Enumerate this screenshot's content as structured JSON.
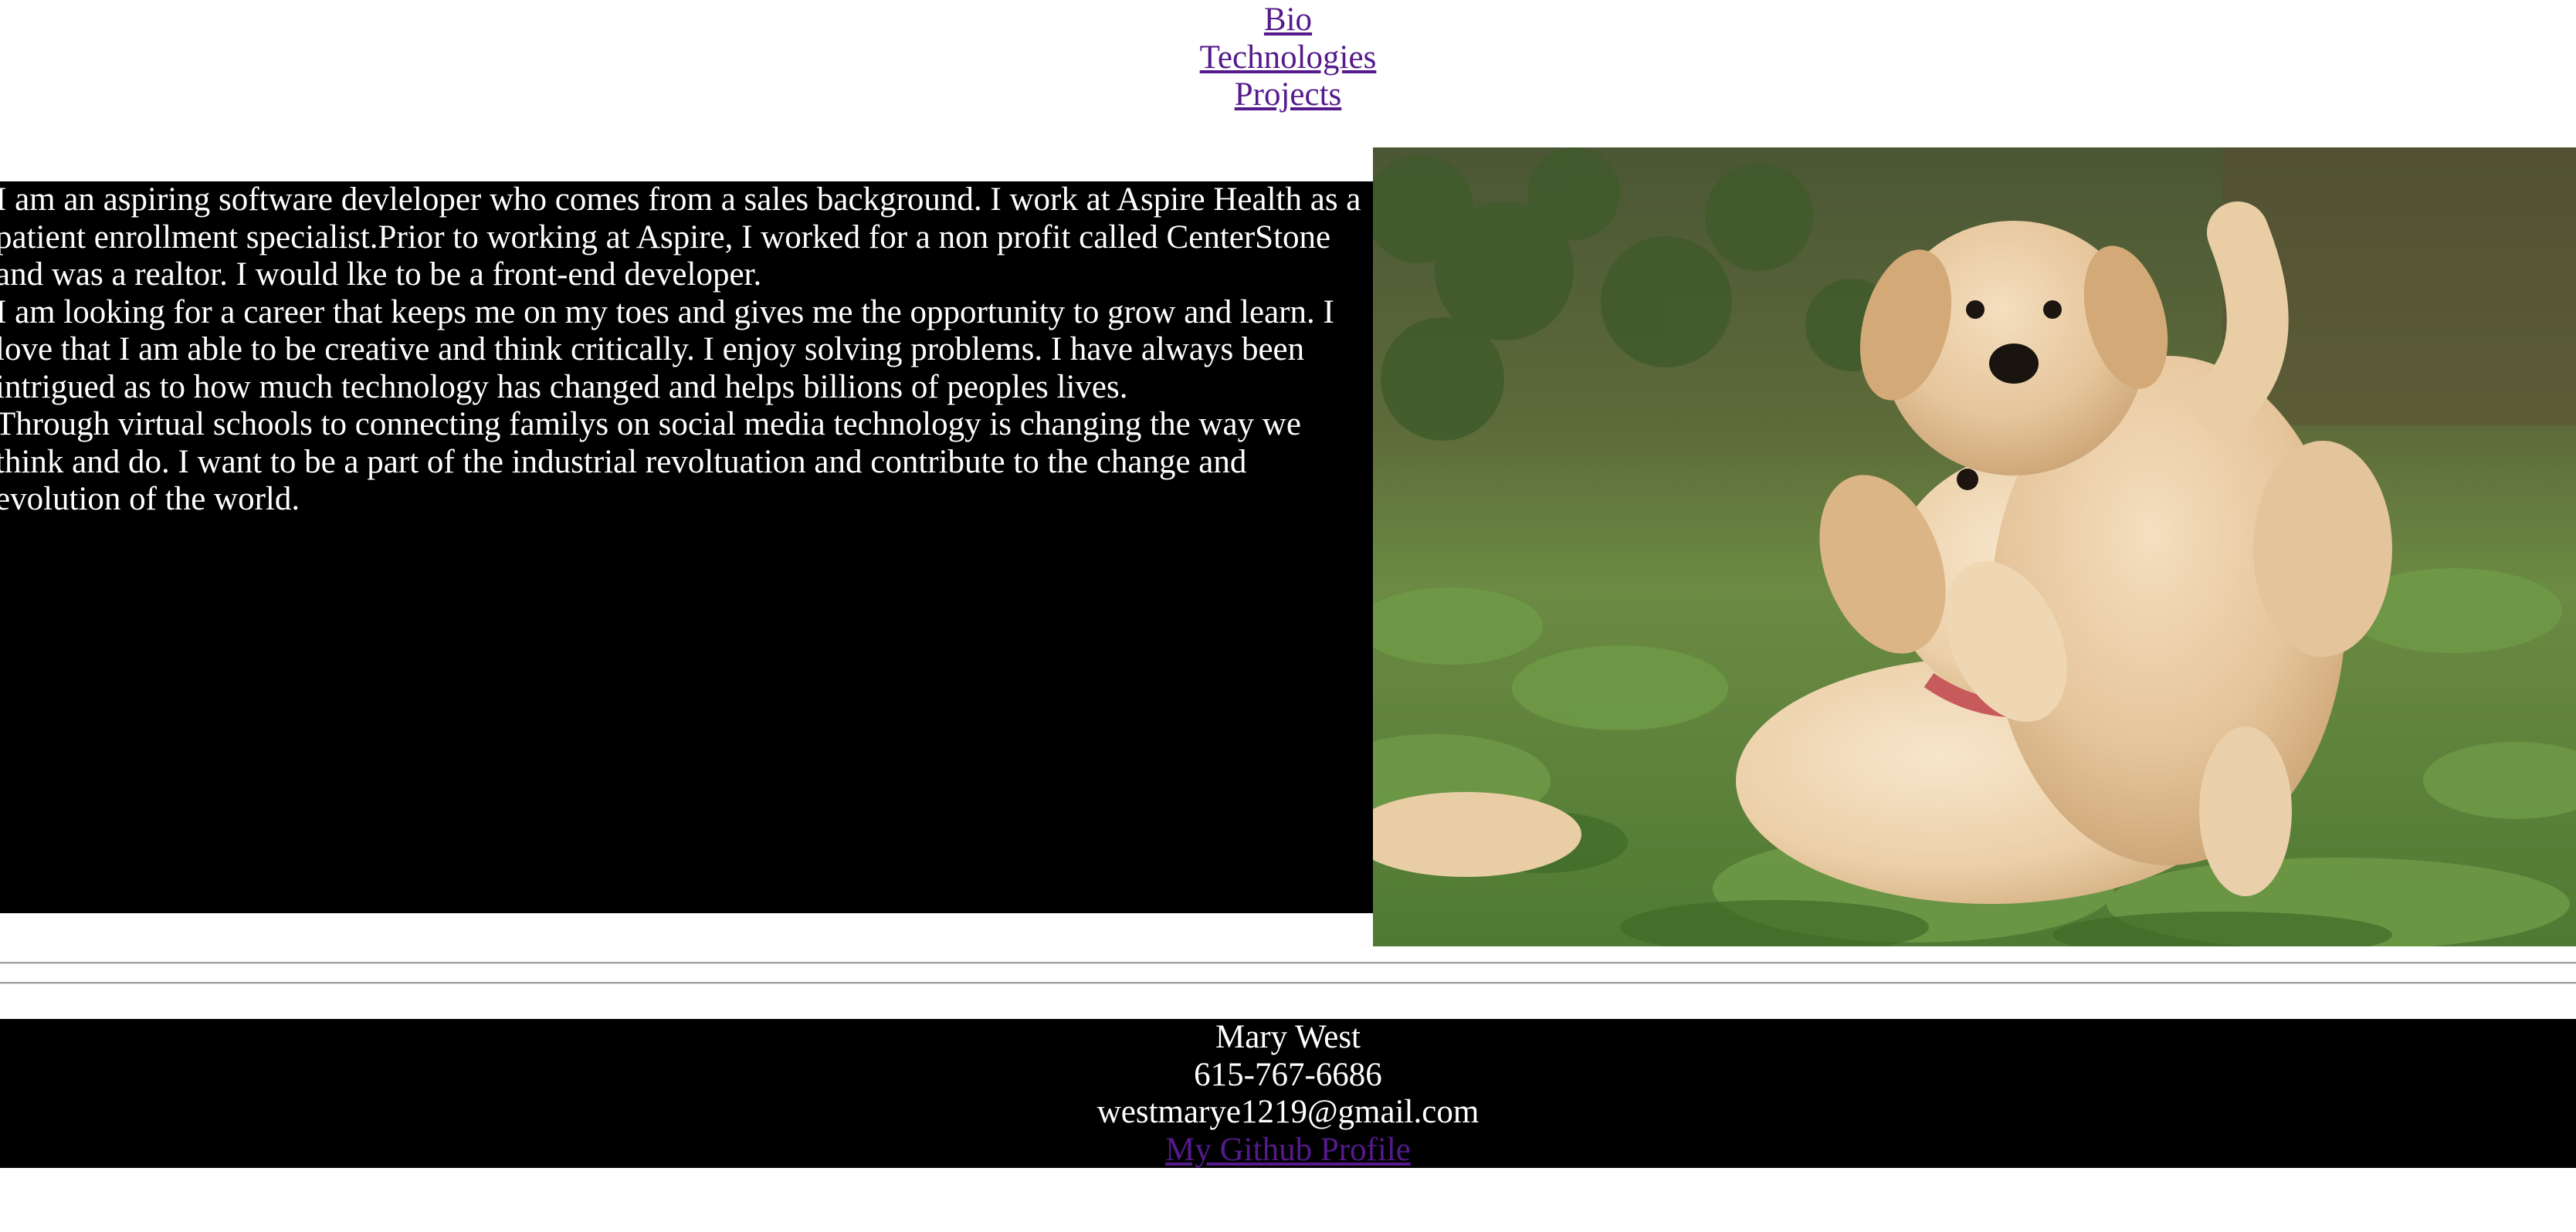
{
  "nav": {
    "bio": "Bio",
    "technologies": "Technologies",
    "projects": "Projects"
  },
  "bio": {
    "paragraphs": [
      "I am an aspiring software devleloper who comes from a sales background. I work at Aspire Health as a patient enrollment specialist.Prior to working at Aspire, I worked for a non profit called CenterStone and was a realtor. I would lke to be a front-end developer.",
      "I am looking for a career that keeps me on my toes and gives me the opportunity to grow and learn. I love that I am able to be creative and think critically. I enjoy solving problems. I have always been intrigued as to how much technology has changed and helps billions of peoples lives.",
      "Through virtual schools to connecting familys on social media technology is changing the way we think and do. I want to be a part of the industrial revoltuation and contribute to the change and evolution of the world."
    ]
  },
  "photo": {
    "subject": "two golden retriever puppies on grass"
  },
  "footer": {
    "name": "Mary West",
    "phone": "615-767-6686",
    "email": "westmarye1219@gmail.com",
    "github_label": "My Github Profile"
  },
  "colors": {
    "link": "#551a8b",
    "section_bg": "#000000",
    "section_text": "#ffffff"
  }
}
